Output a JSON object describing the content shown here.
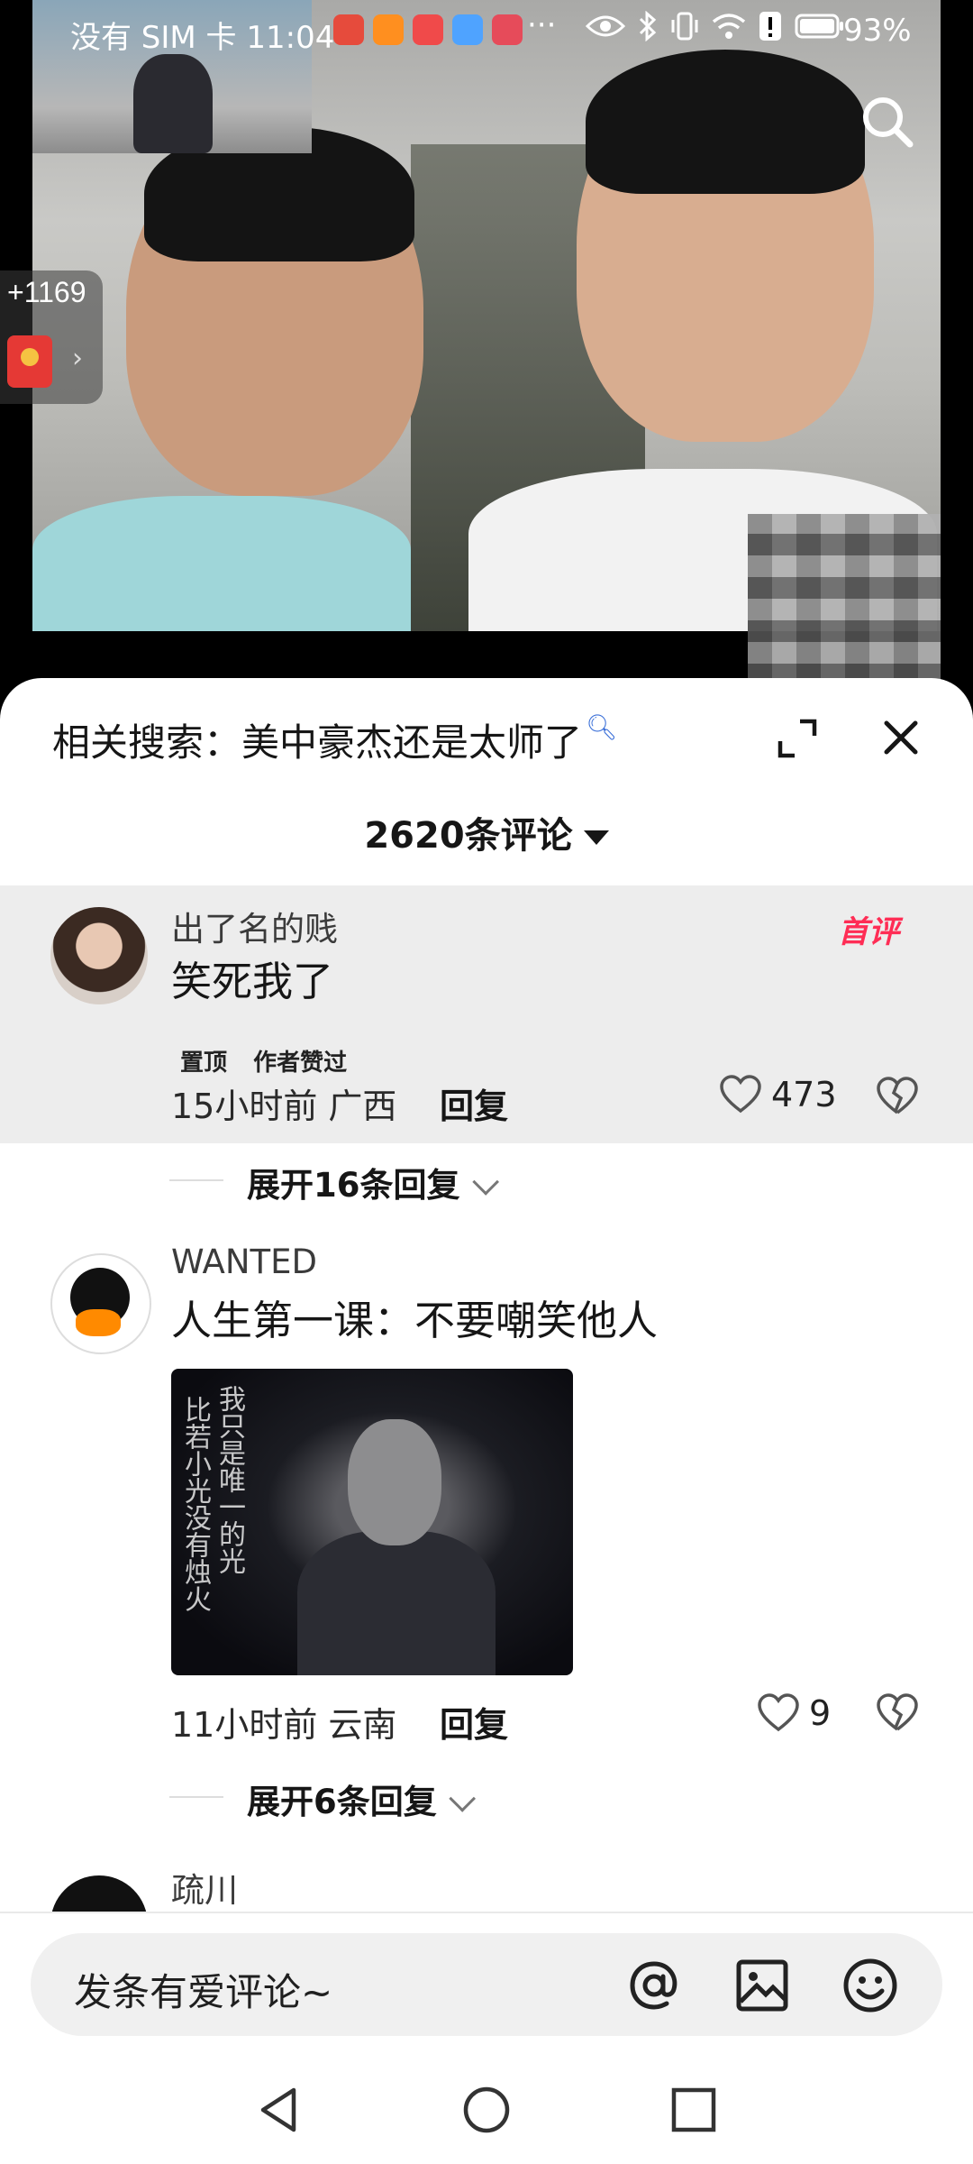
{
  "status_bar": {
    "carrier": "没有 SIM 卡",
    "time": "11:04",
    "more": "···",
    "battery": "93%"
  },
  "video": {
    "red_packet_count": "+1169"
  },
  "sheet": {
    "related_search_label": "相关搜索：美中豪杰还是太师了",
    "comment_count": "2620条评论"
  },
  "comments": [
    {
      "username": "出了名的贱",
      "text": "笑死我了",
      "badge": "首评",
      "tags": [
        "置顶",
        "作者赞过"
      ],
      "time_location": "15小时前 广西",
      "reply_label": "回复",
      "likes": "473",
      "expand_label": "展开16条回复"
    },
    {
      "username": "WANTED",
      "text": "人生第一课：不要嘲笑他人",
      "image_calligraphy_left": "比若小光没有烛火",
      "image_calligraphy_right": "我只是唯一的光",
      "time_location": "11小时前 云南",
      "reply_label": "回复",
      "likes": "9",
      "expand_label": "展开6条回复"
    },
    {
      "username": "疏川"
    }
  ],
  "input": {
    "placeholder": "发条有爱评论~"
  },
  "colors": {
    "accent_first_comment": "#ff2d55",
    "pinned_background": "#ededed"
  }
}
